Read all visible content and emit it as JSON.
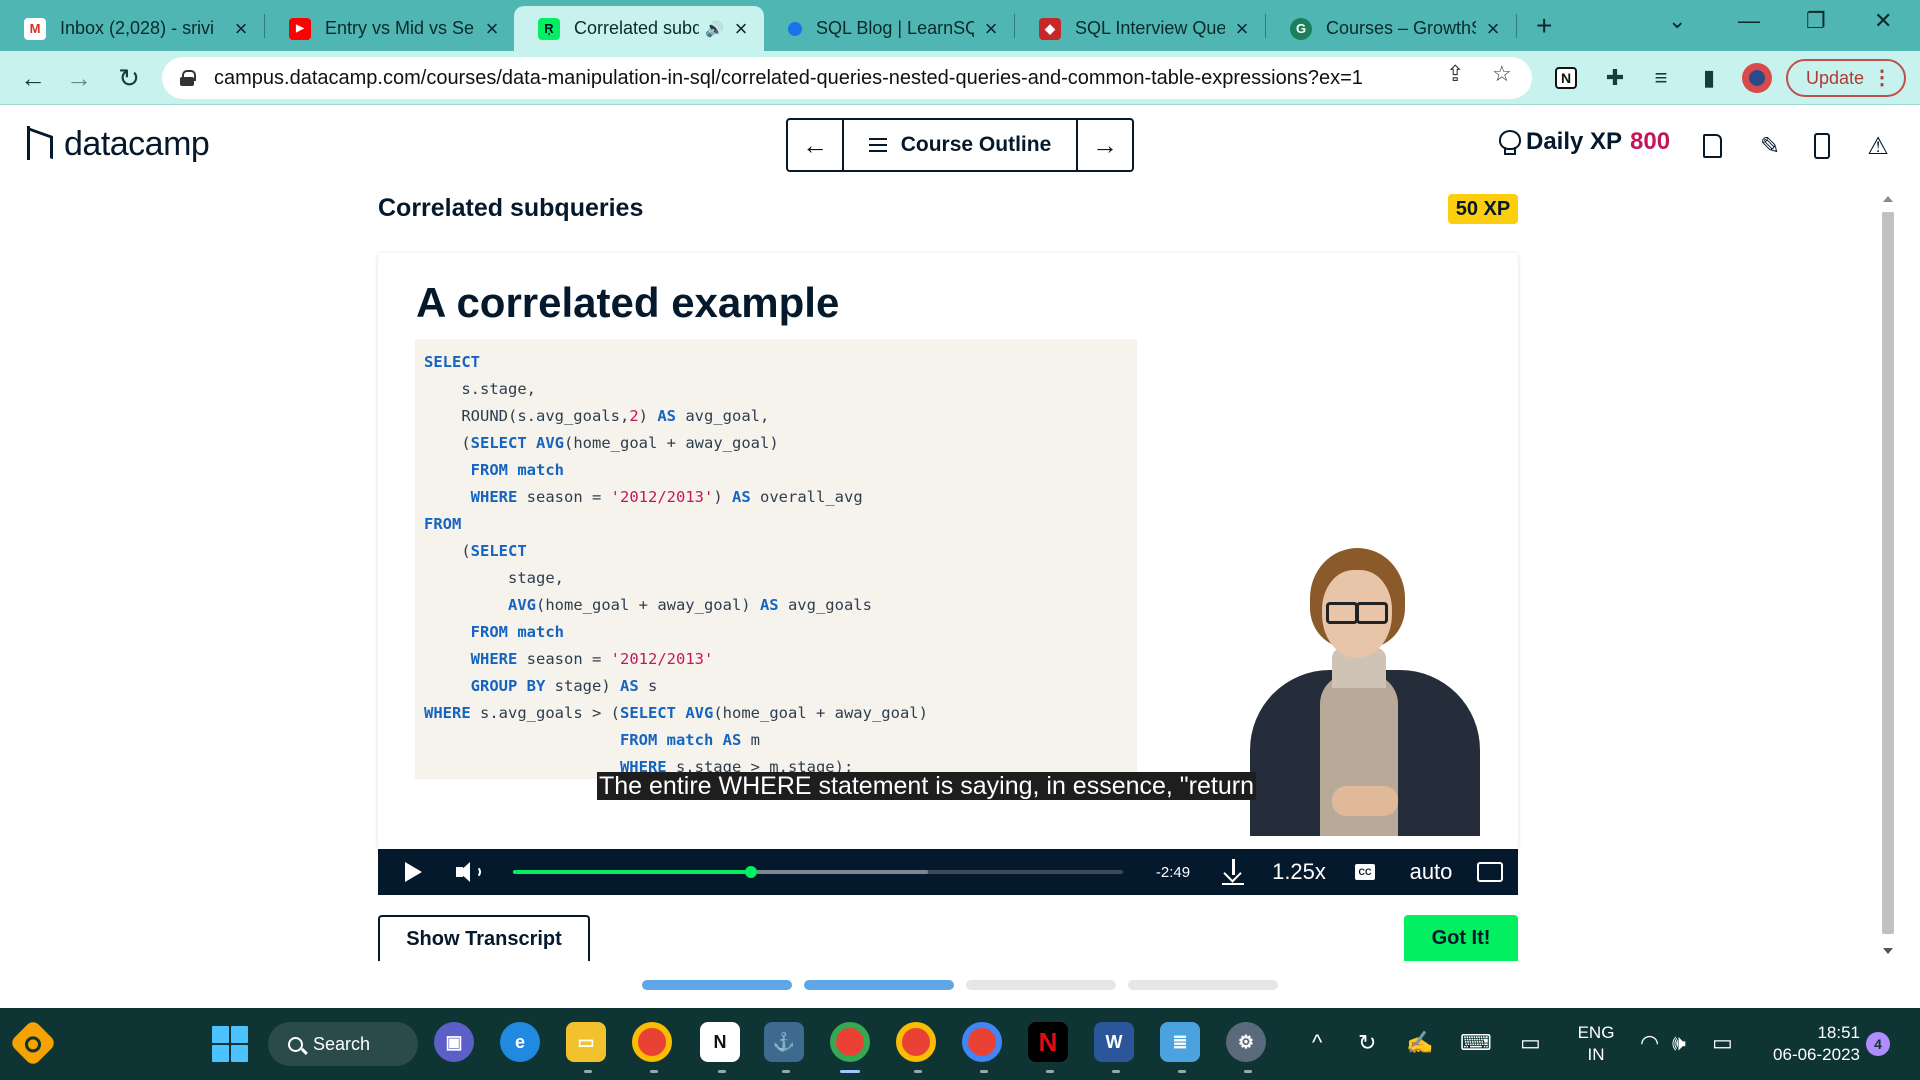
{
  "browser": {
    "tabs": [
      {
        "title": "Inbox (2,028) - srivi",
        "favicon": "gmail-icon",
        "favicon_color": "#d93025"
      },
      {
        "title": "Entry vs Mid vs Sen",
        "favicon": "youtube-icon",
        "favicon_color": "#ff0000"
      },
      {
        "title": "Correlated subq",
        "favicon": "datacamp-icon",
        "favicon_color": "#03ef62",
        "active": true,
        "audio": true
      },
      {
        "title": "SQL Blog | LearnSQ",
        "favicon": "learnsql-icon",
        "favicon_color": "#1a73e8"
      },
      {
        "title": "SQL Interview Ques",
        "favicon": "interview-icon",
        "favicon_color": "#c62828"
      },
      {
        "title": "Courses – GrowthS",
        "favicon": "growth-icon",
        "favicon_color": "#1b7f5b"
      }
    ],
    "url": "campus.datacamp.com/courses/data-manipulation-in-sql/correlated-queries-nested-queries-and-common-table-expressions?ex=1",
    "update_label": "Update"
  },
  "header": {
    "logo_text": "datacamp",
    "course_outline_label": "Course Outline",
    "daily_xp_label": "Daily XP",
    "daily_xp_value": "800"
  },
  "lesson": {
    "title": "Correlated subqueries",
    "xp_badge": "50 XP"
  },
  "slide": {
    "title": "A correlated example",
    "code": [
      [
        {
          "t": "SELECT",
          "c": "kw"
        }
      ],
      [
        {
          "t": "    s.stage,"
        }
      ],
      [
        {
          "t": "    ROUND(s.avg_goals,"
        },
        {
          "t": "2",
          "c": "num"
        },
        {
          "t": ") "
        },
        {
          "t": "AS",
          "c": "kw"
        },
        {
          "t": " avg_goal,"
        }
      ],
      [
        {
          "t": "    ("
        },
        {
          "t": "SELECT",
          "c": "kw"
        },
        {
          "t": " "
        },
        {
          "t": "AVG",
          "c": "kw"
        },
        {
          "t": "(home_goal + away_goal)"
        }
      ],
      [
        {
          "t": "     "
        },
        {
          "t": "FROM",
          "c": "kw"
        },
        {
          "t": " "
        },
        {
          "t": "match",
          "c": "kw"
        }
      ],
      [
        {
          "t": "     "
        },
        {
          "t": "WHERE",
          "c": "kw"
        },
        {
          "t": " season = "
        },
        {
          "t": "'2012/2013'",
          "c": "str"
        },
        {
          "t": ") "
        },
        {
          "t": "AS",
          "c": "kw"
        },
        {
          "t": " overall_avg"
        }
      ],
      [
        {
          "t": "FROM",
          "c": "kw"
        }
      ],
      [
        {
          "t": "    ("
        },
        {
          "t": "SELECT",
          "c": "kw"
        }
      ],
      [
        {
          "t": "         stage,"
        }
      ],
      [
        {
          "t": "         "
        },
        {
          "t": "AVG",
          "c": "kw"
        },
        {
          "t": "(home_goal + away_goal) "
        },
        {
          "t": "AS",
          "c": "kw"
        },
        {
          "t": " avg_goals"
        }
      ],
      [
        {
          "t": "     "
        },
        {
          "t": "FROM",
          "c": "kw"
        },
        {
          "t": " "
        },
        {
          "t": "match",
          "c": "kw"
        }
      ],
      [
        {
          "t": "     "
        },
        {
          "t": "WHERE",
          "c": "kw"
        },
        {
          "t": " season = "
        },
        {
          "t": "'2012/2013'",
          "c": "str"
        }
      ],
      [
        {
          "t": "     "
        },
        {
          "t": "GROUP BY",
          "c": "kw"
        },
        {
          "t": " stage) "
        },
        {
          "t": "AS",
          "c": "kw"
        },
        {
          "t": " s"
        }
      ],
      [
        {
          "t": "WHERE",
          "c": "kw"
        },
        {
          "t": " s.avg_goals > ("
        },
        {
          "t": "SELECT",
          "c": "kw"
        },
        {
          "t": " "
        },
        {
          "t": "AVG",
          "c": "kw"
        },
        {
          "t": "(home_goal + away_goal)"
        }
      ],
      [
        {
          "t": "                     "
        },
        {
          "t": "FROM",
          "c": "kw"
        },
        {
          "t": " "
        },
        {
          "t": "match",
          "c": "kw"
        },
        {
          "t": " "
        },
        {
          "t": "AS",
          "c": "kw"
        },
        {
          "t": " m"
        }
      ],
      [
        {
          "t": "                     "
        },
        {
          "t": "WHERE",
          "c": "kw"
        },
        {
          "t": " s.stage > m.stage);"
        }
      ]
    ],
    "caption": "The entire WHERE statement is saying, in essence, \"return"
  },
  "player": {
    "progress_fraction": 0.39,
    "buffered_fraction": 0.68,
    "time_remaining": "-2:49",
    "speed": "1.25x",
    "cc_label": "CC",
    "quality": "auto"
  },
  "actions": {
    "show_transcript": "Show Transcript",
    "got_it": "Got It!"
  },
  "exercise_progress": [
    true,
    true,
    false,
    false
  ],
  "taskbar": {
    "search_label": "Search",
    "apps": [
      "teams-icon",
      "edge-icon",
      "file-explorer-icon",
      "chrome-icon",
      "notion-icon",
      "mysql-workbench-icon",
      "chrome-profile-1-icon",
      "chrome-profile-2-icon",
      "chrome-profile-3-icon",
      "netflix-icon",
      "word-icon",
      "notepad-icon",
      "settings-icon"
    ],
    "lang_line1": "ENG",
    "lang_line2": "IN",
    "time": "18:51",
    "date": "06-06-2023",
    "notifications": "4"
  },
  "colors": {
    "accent_green": "#03ef62",
    "navy": "#05192d",
    "xp_pink": "#c2185b",
    "xp_badge_yellow": "#fcce0d",
    "tab_strip": "#4fb6b4"
  }
}
